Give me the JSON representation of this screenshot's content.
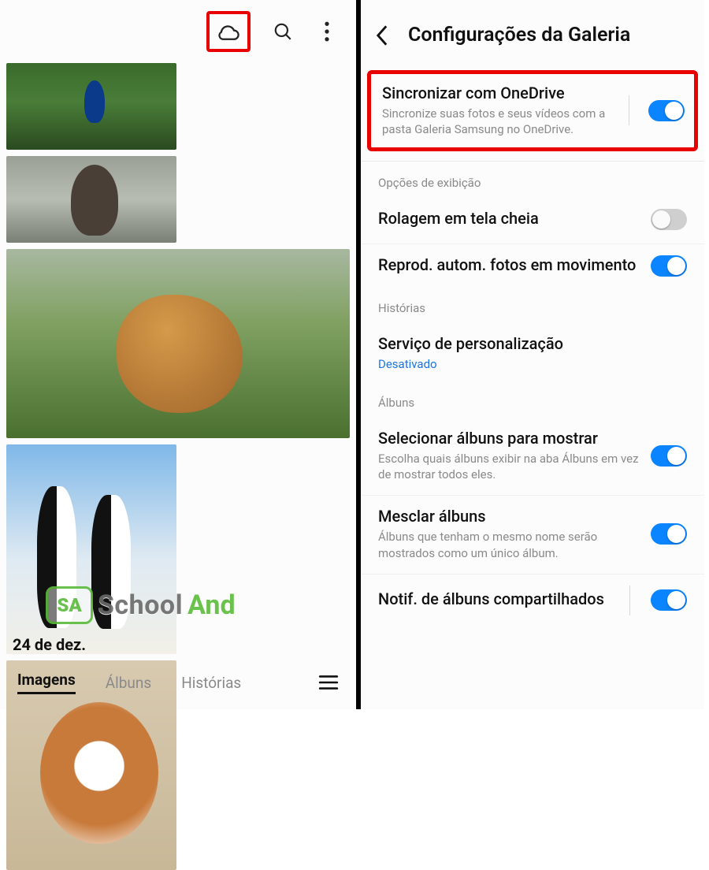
{
  "left": {
    "icons": {
      "cloud": "cloud",
      "search": "search",
      "more": "more"
    },
    "date": "24 de dez.",
    "tabs": [
      "Imagens",
      "Álbuns",
      "Histórias"
    ],
    "active_tab": 0,
    "watermark": {
      "badge": "SA",
      "t1": "School",
      "t2": "And"
    }
  },
  "right": {
    "title": "Configurações da Galeria",
    "sync": {
      "title": "Sincronizar com OneDrive",
      "sub": "Sincronize suas fotos e seus vídeos com a pasta Galeria Samsung no OneDrive.",
      "on": true
    },
    "sec_display": "Opções de exibição",
    "fullscreen_scroll": {
      "title": "Rolagem em tela cheia",
      "on": false
    },
    "autoplay": {
      "title": "Reprod. autom. fotos em movimento",
      "on": true
    },
    "sec_stories": "Histórias",
    "personalization": {
      "title": "Serviço de personalização",
      "sub": "Desativado"
    },
    "sec_albums": "Álbuns",
    "select_albums": {
      "title": "Selecionar álbuns para mostrar",
      "sub": "Escolha quais álbuns exibir na aba Álbuns em vez de mostrar todos eles.",
      "on": true
    },
    "merge_albums": {
      "title": "Mesclar álbuns",
      "sub": "Álbuns que tenham o mesmo nome serão mostrados como um único álbum.",
      "on": true
    },
    "shared_notif": {
      "title": "Notif. de álbuns compartilhados",
      "on": true
    }
  }
}
